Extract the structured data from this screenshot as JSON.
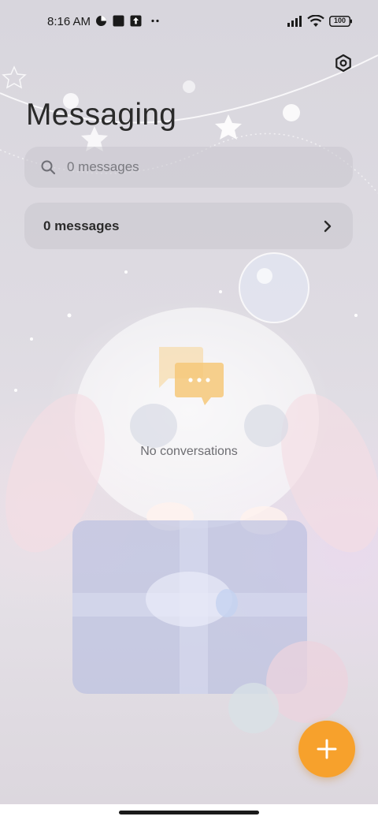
{
  "status_bar": {
    "time": "8:16 AM",
    "battery": "100",
    "icons": [
      "data-saver-icon",
      "app-square-icon",
      "upload-icon",
      "more-dots-icon",
      "signal-icon",
      "wifi-icon",
      "battery-icon"
    ]
  },
  "header": {
    "title": "Messaging",
    "settings_icon": "gear-icon"
  },
  "search": {
    "placeholder": "0 messages",
    "value": ""
  },
  "message_summary": {
    "label": "0 messages",
    "chevron_icon": "chevron-right-icon"
  },
  "empty_state": {
    "icon": "chat-bubbles-icon",
    "text": "No conversations"
  },
  "fab": {
    "icon": "plus-icon"
  },
  "colors": {
    "accent": "#f7a12c",
    "card_bg": "#c8c6ce",
    "empty_bubble_back": "#f7dcae",
    "empty_bubble_front": "#f6c879"
  }
}
